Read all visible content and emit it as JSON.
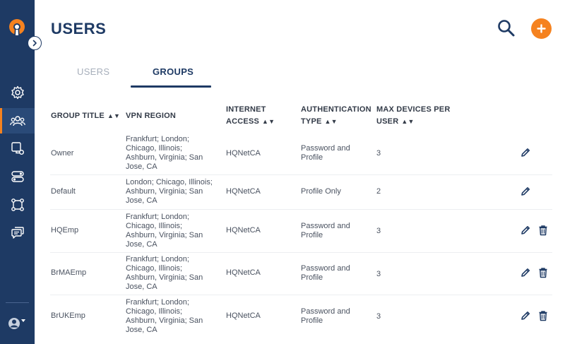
{
  "app": {
    "accent_color": "#f5821f",
    "sidebar_color": "#1e3a64"
  },
  "sidebar": {
    "logo": "openvpn-logo-icon",
    "expand_icon": "chevron-right-icon",
    "items": [
      {
        "name": "settings",
        "icon": "gear-icon"
      },
      {
        "name": "users",
        "icon": "users-icon",
        "active": true
      },
      {
        "name": "networks",
        "icon": "network-icon"
      },
      {
        "name": "access",
        "icon": "toggles-icon"
      },
      {
        "name": "topology",
        "icon": "nodes-icon"
      },
      {
        "name": "messages",
        "icon": "chat-icon"
      }
    ],
    "profile_icon": "user-circle-icon"
  },
  "header": {
    "title": "USERS",
    "search_icon": "search-icon",
    "add_icon": "plus-icon"
  },
  "tabs": [
    {
      "label": "USERS",
      "active": false
    },
    {
      "label": "GROUPS",
      "active": true
    }
  ],
  "table": {
    "columns": [
      "GROUP TITLE",
      "VPN REGION",
      "INTERNET ACCESS",
      "AUTHENTICATION TYPE",
      "MAX DEVICES PER USER"
    ],
    "col_lines": {
      "internet": [
        "INTERNET",
        "ACCESS"
      ],
      "auth": [
        "AUTHENTICATION",
        "TYPE"
      ],
      "max": [
        "MAX DEVICES PER",
        "USER"
      ]
    },
    "rows": [
      {
        "title": "Owner",
        "region": [
          "Frankfurt; London;",
          "Chicago, Illinois;",
          "Ashburn, Virginia; San",
          "Jose, CA"
        ],
        "internet": "HQNetCA",
        "auth": [
          "Password and",
          "Profile"
        ],
        "max": "3",
        "deletable": false
      },
      {
        "title": "Default",
        "region": [
          "London; Chicago, Illinois;",
          "Ashburn, Virginia; San",
          "Jose, CA"
        ],
        "internet": "HQNetCA",
        "auth": [
          "Profile Only"
        ],
        "max": "2",
        "deletable": false
      },
      {
        "title": "HQEmp",
        "region": [
          "Frankfurt; London;",
          "Chicago, Illinois;",
          "Ashburn, Virginia; San",
          "Jose, CA"
        ],
        "internet": "HQNetCA",
        "auth": [
          "Password and",
          "Profile"
        ],
        "max": "3",
        "deletable": true
      },
      {
        "title": "BrMAEmp",
        "region": [
          "Frankfurt; London;",
          "Chicago, Illinois;",
          "Ashburn, Virginia; San",
          "Jose, CA"
        ],
        "internet": "HQNetCA",
        "auth": [
          "Password and",
          "Profile"
        ],
        "max": "3",
        "deletable": true
      },
      {
        "title": "BrUKEmp",
        "region": [
          "Frankfurt; London;",
          "Chicago, Illinois;",
          "Ashburn, Virginia; San",
          "Jose, CA"
        ],
        "internet": "HQNetCA",
        "auth": [
          "Password and",
          "Profile"
        ],
        "max": "3",
        "deletable": true
      }
    ]
  }
}
